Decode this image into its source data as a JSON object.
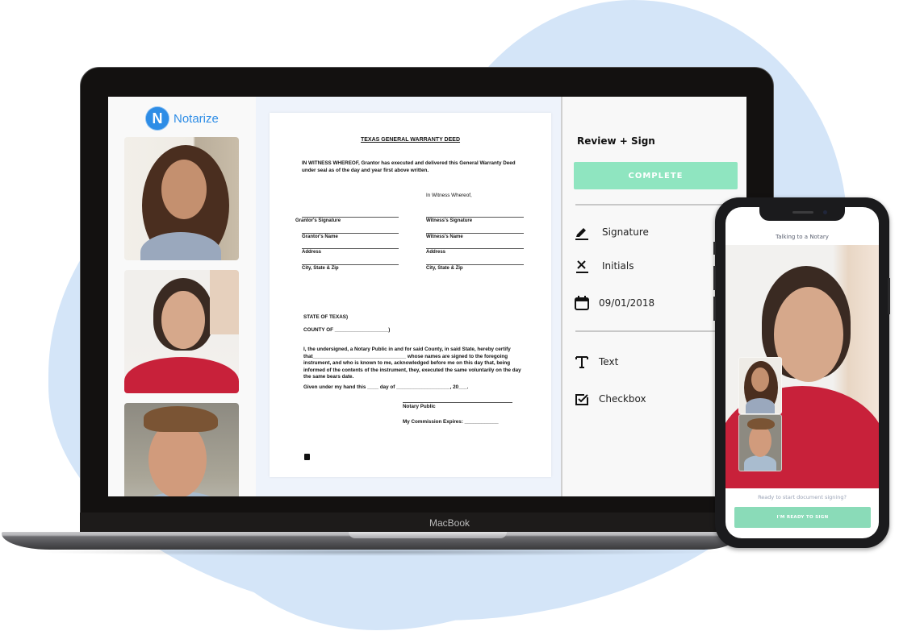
{
  "colors": {
    "brand_blue": "#2e8de6",
    "accent_green": "#8fe5c0",
    "background_blob": "#d4e5f8"
  },
  "laptop": {
    "label": "MacBook"
  },
  "app": {
    "logo_letter": "N",
    "brand_name": "Notarize",
    "participants": [
      {
        "role": "notary",
        "description": "woman with curly hair and headset"
      },
      {
        "role": "signer",
        "description": "woman in red top"
      },
      {
        "role": "witness",
        "description": "smiling man"
      }
    ],
    "document": {
      "title": "TEXAS GENERAL WARRANTY DEED",
      "intro": "IN WITNESS WHEREOF, Grantor has executed and delivered this General  Warranty Deed under seal as of the day and year first above written.",
      "witness_heading": "In Witness Whereof,",
      "left_fields": [
        "Grantor's Signature",
        "Grantor's Name",
        "Address",
        "City, State & Zip"
      ],
      "right_fields": [
        "Witness's Signature",
        "Witness's Name",
        "Address",
        "City, State & Zip"
      ],
      "state_line": "STATE OF TEXAS)",
      "county_line": "COUNTY OF ___________________)",
      "certification": "I, the undersigned, a Notary Public in and for said County, in said State, hereby certify that_________________________________ whose names are signed to the foregoing instrument, and who is known to me, acknowledged before me on this day that, being informed of the contents of the instrument, they, executed the same voluntarily on the day the same bears date.",
      "given_line": "Given under my hand this ____ day of ___________________, 20___.",
      "notary_label": "Notary Public",
      "commission_label": "My Commission Expires: ____________"
    },
    "panel": {
      "title": "Review + Sign",
      "complete_button": "COMPLETE",
      "tools": [
        {
          "icon": "pen-icon",
          "label": "Signature"
        },
        {
          "icon": "x-mark-icon",
          "label": "Initials"
        },
        {
          "icon": "calendar-icon",
          "label": "09/01/2018"
        },
        {
          "icon": "text-t-icon",
          "label": "Text"
        },
        {
          "icon": "checkbox-icon",
          "label": "Checkbox"
        }
      ]
    }
  },
  "phone": {
    "header": "Talking to a Notary",
    "prompt": "Ready to start document signing?",
    "ready_button": "I'M READY TO SIGN"
  }
}
